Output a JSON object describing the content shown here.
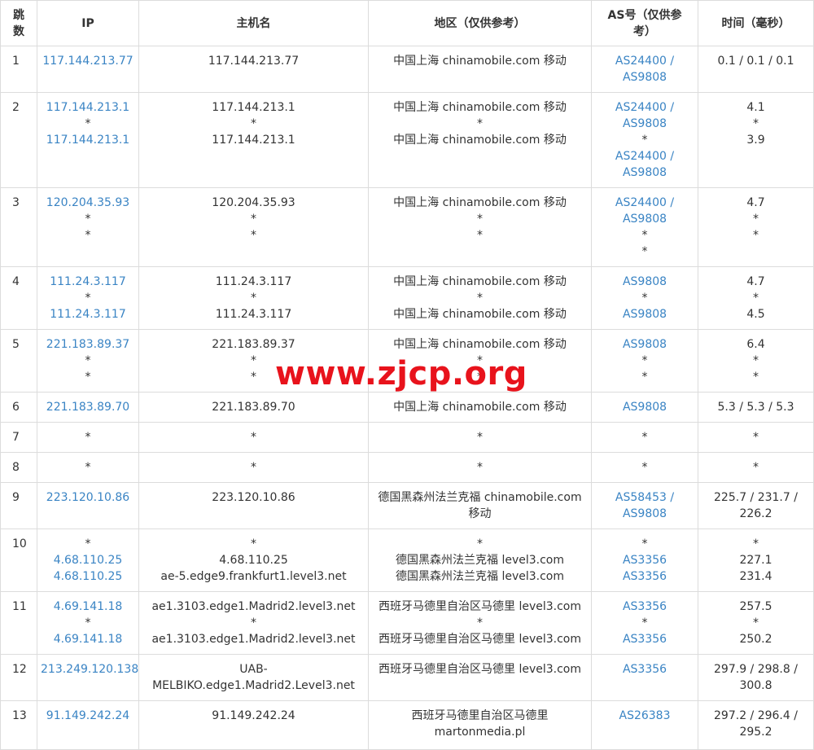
{
  "headers": {
    "hop": [
      "跳",
      "数"
    ],
    "ip": "IP",
    "hostname": "主机名",
    "region": "地区（仅供参考）",
    "as": [
      "AS号（仅供参",
      "考）"
    ],
    "time": "时间（毫秒）"
  },
  "rows": [
    {
      "hop": "1",
      "ip": [
        "117.144.213.77"
      ],
      "host": [
        "117.144.213.77"
      ],
      "region": [
        "中国上海 chinamobile.com 移动"
      ],
      "as": [
        "AS24400 /",
        "AS9808"
      ],
      "time": [
        "0.1 / 0.1 / 0.1"
      ]
    },
    {
      "hop": "2",
      "ip": [
        "117.144.213.1",
        "*",
        "117.144.213.1"
      ],
      "host": [
        "117.144.213.1",
        "*",
        "117.144.213.1"
      ],
      "region": [
        "中国上海 chinamobile.com 移动",
        "*",
        "中国上海 chinamobile.com 移动"
      ],
      "as": [
        "AS24400 /",
        "AS9808",
        "*",
        "AS24400 /",
        "AS9808"
      ],
      "time": [
        "4.1",
        "*",
        "3.9"
      ]
    },
    {
      "hop": "3",
      "ip": [
        "120.204.35.93",
        "*",
        "*"
      ],
      "host": [
        "120.204.35.93",
        "*",
        "*"
      ],
      "region": [
        "中国上海 chinamobile.com 移动",
        "*",
        "*"
      ],
      "as": [
        "AS24400 /",
        "AS9808",
        "*",
        "*"
      ],
      "time": [
        "4.7",
        "*",
        "*"
      ]
    },
    {
      "hop": "4",
      "ip": [
        "111.24.3.117",
        "*",
        "111.24.3.117"
      ],
      "host": [
        "111.24.3.117",
        "*",
        "111.24.3.117"
      ],
      "region": [
        "中国上海 chinamobile.com 移动",
        "*",
        "中国上海 chinamobile.com 移动"
      ],
      "as": [
        "AS9808",
        "*",
        "AS9808"
      ],
      "time": [
        "4.7",
        "*",
        "4.5"
      ]
    },
    {
      "hop": "5",
      "ip": [
        "221.183.89.37",
        "*",
        "*"
      ],
      "host": [
        "221.183.89.37",
        "*",
        "*"
      ],
      "region": [
        "中国上海 chinamobile.com 移动",
        "*",
        "*"
      ],
      "as": [
        "AS9808",
        "*",
        "*"
      ],
      "time": [
        "6.4",
        "*",
        "*"
      ]
    },
    {
      "hop": "6",
      "ip": [
        "221.183.89.70"
      ],
      "host": [
        "221.183.89.70"
      ],
      "region": [
        "中国上海 chinamobile.com 移动"
      ],
      "as": [
        "AS9808"
      ],
      "time": [
        "5.3 / 5.3 / 5.3"
      ]
    },
    {
      "hop": "7",
      "ip": [
        "*"
      ],
      "host": [
        "*"
      ],
      "region": [
        "*"
      ],
      "as": [
        "*"
      ],
      "time": [
        "*"
      ]
    },
    {
      "hop": "8",
      "ip": [
        "*"
      ],
      "host": [
        "*"
      ],
      "region": [
        "*"
      ],
      "as": [
        "*"
      ],
      "time": [
        "*"
      ]
    },
    {
      "hop": "9",
      "ip": [
        "223.120.10.86"
      ],
      "host": [
        "223.120.10.86"
      ],
      "region": [
        "德国黑森州法兰克福 chinamobile.com",
        "移动"
      ],
      "as": [
        "AS58453 /",
        "AS9808"
      ],
      "time": [
        "225.7 / 231.7 /",
        "226.2"
      ]
    },
    {
      "hop": "10",
      "ip": [
        "*",
        "4.68.110.25",
        "4.68.110.25"
      ],
      "host": [
        "*",
        "4.68.110.25",
        "ae-5.edge9.frankfurt1.level3.net"
      ],
      "region": [
        "*",
        "德国黑森州法兰克福 level3.com",
        "德国黑森州法兰克福 level3.com"
      ],
      "as": [
        "*",
        "AS3356",
        "AS3356"
      ],
      "time": [
        "*",
        "227.1",
        "231.4"
      ]
    },
    {
      "hop": "11",
      "ip": [
        "4.69.141.18",
        "*",
        "4.69.141.18"
      ],
      "host": [
        "ae1.3103.edge1.Madrid2.level3.net",
        "*",
        "ae1.3103.edge1.Madrid2.level3.net"
      ],
      "region": [
        "西班牙马德里自治区马德里 level3.com",
        "*",
        "西班牙马德里自治区马德里 level3.com"
      ],
      "as": [
        "AS3356",
        "*",
        "AS3356"
      ],
      "time": [
        "257.5",
        "*",
        "250.2"
      ]
    },
    {
      "hop": "12",
      "ip": [
        "213.249.120.138"
      ],
      "host": [
        "UAB-",
        "MELBIKO.edge1.Madrid2.Level3.net"
      ],
      "region": [
        "西班牙马德里自治区马德里 level3.com"
      ],
      "as": [
        "AS3356"
      ],
      "time": [
        "297.9 / 298.8 /",
        "300.8"
      ]
    },
    {
      "hop": "13",
      "ip": [
        "91.149.242.24"
      ],
      "host": [
        "91.149.242.24"
      ],
      "region": [
        "西班牙马德里自治区马德里",
        "martonmedia.pl"
      ],
      "as": [
        "AS26383"
      ],
      "time": [
        "297.2 / 296.4 /",
        "295.2"
      ]
    }
  ],
  "watermark": "www.zjcp.org",
  "colors": {
    "link": "#3a84c4",
    "watermark": "#e8131c",
    "border": "#dcdcdc"
  }
}
